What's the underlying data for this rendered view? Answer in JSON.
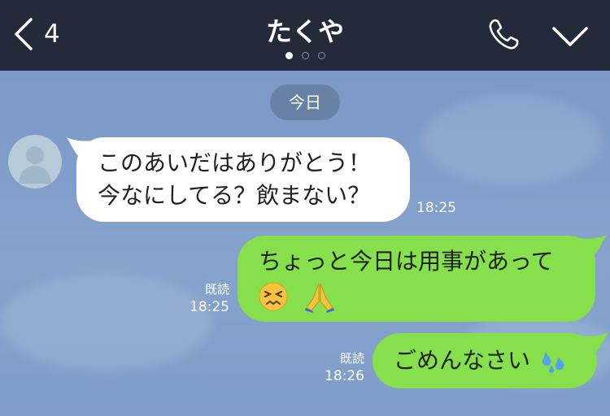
{
  "header": {
    "back_count": "4",
    "title": "たくや",
    "icons": [
      "chevron-left-icon",
      "phone-icon",
      "chevron-down-icon"
    ]
  },
  "chat": {
    "date_label": "今日",
    "messages": [
      {
        "direction": "incoming",
        "lines": [
          "このあいだはありがとう！",
          "今なにしてる？飲まない？"
        ],
        "time": "18:25"
      },
      {
        "direction": "outgoing",
        "lines": [
          "ちょっと今日は用事があって"
        ],
        "emojis": [
          "persevering-face-icon",
          "folded-hands-icon"
        ],
        "read": "既読",
        "time": "18:25"
      },
      {
        "direction": "outgoing",
        "lines": [
          "ごめんなさい"
        ],
        "emojis": [
          "sweat-droplets-icon"
        ],
        "read": "既読",
        "time": "18:26"
      }
    ]
  },
  "colors": {
    "header_bg": "#232a3a",
    "chat_bg": "#7f9cc9",
    "outgoing_bubble": "#85e04b",
    "incoming_bubble": "#ffffff",
    "date_chip": "#6a81a6"
  }
}
